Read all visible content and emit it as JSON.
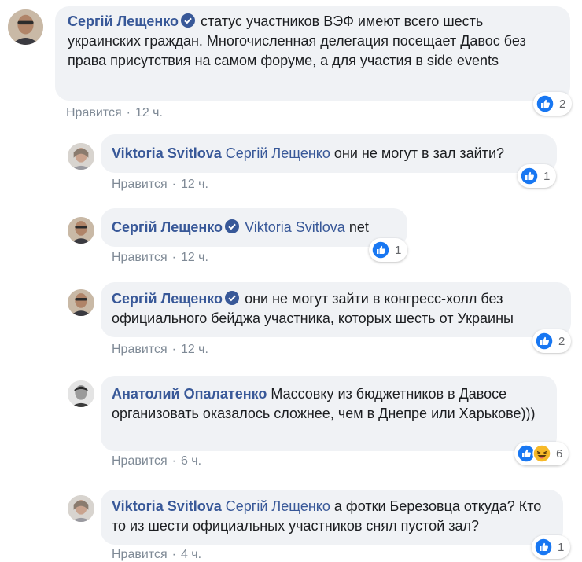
{
  "comments": [
    {
      "author": "Сергій Лещенко",
      "verified": true,
      "mention": "",
      "text": "статус участников ВЭФ имеют всего шесть украинских граждан. Многочисленная делегация посещает Давос без права присутствия на самом форуме, а для участия в side events",
      "like_label": "Нравится",
      "time": "12 ч.",
      "reactions": [
        "like"
      ],
      "reaction_count": "2"
    },
    {
      "author": "Viktoria Svitlova",
      "verified": false,
      "mention": "Сергій Лещенко",
      "text": "они не могут в зал зайти?",
      "like_label": "Нравится",
      "time": "12 ч.",
      "reactions": [
        "like"
      ],
      "reaction_count": "1"
    },
    {
      "author": "Сергій Лещенко",
      "verified": true,
      "mention": "Viktoria Svitlova",
      "text": "net",
      "like_label": "Нравится",
      "time": "12 ч.",
      "reactions": [
        "like"
      ],
      "reaction_count": "1"
    },
    {
      "author": "Сергій Лещенко",
      "verified": true,
      "mention": "",
      "text": "они не могут зайти в конгресс-холл без официального бейджа участника, которых шесть от Украины",
      "like_label": "Нравится",
      "time": "12 ч.",
      "reactions": [
        "like"
      ],
      "reaction_count": "2"
    },
    {
      "author": "Анатолий Опалатенко",
      "verified": false,
      "mention": "",
      "text": "Массовку из бюджетников в Давосе организовать оказалось сложнее, чем в Днепре или Харькове)))",
      "like_label": "Нравится",
      "time": "6 ч.",
      "reactions": [
        "like",
        "haha"
      ],
      "reaction_count": "6"
    },
    {
      "author": "Viktoria Svitlova",
      "verified": false,
      "mention": "Сергій Лещенко",
      "text": "а фотки Березовца откуда? Кто то из шести официальных участников снял пустой зал?",
      "like_label": "Нравится",
      "time": "4 ч.",
      "reactions": [
        "like"
      ],
      "reaction_count": "1"
    }
  ],
  "colors": {
    "link": "#385898",
    "bubble": "#f0f2f5",
    "like_blue": "#1877f2",
    "haha_yellow": "#f7b928"
  }
}
